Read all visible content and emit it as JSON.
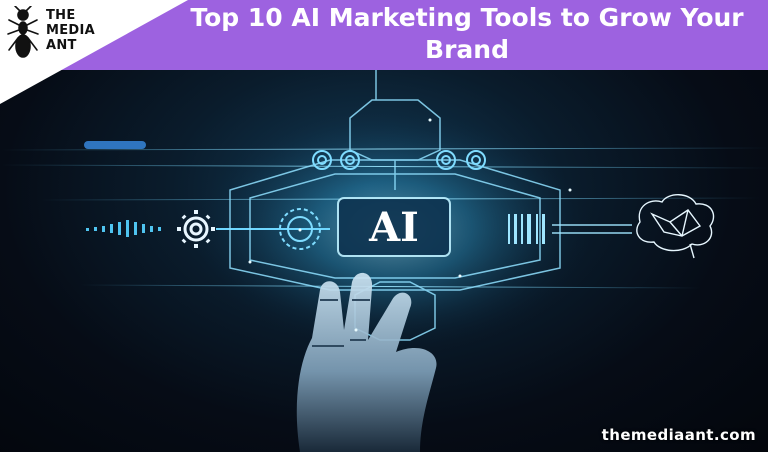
{
  "header": {
    "logo": {
      "line1": "THE",
      "line2": "MEDIA",
      "line3": "ANT"
    },
    "title": "Top 10 AI Marketing Tools to Grow Your Brand"
  },
  "hero": {
    "chip_label": "AI"
  },
  "footer": {
    "website": "themediaant.com"
  },
  "colors": {
    "header_bg": "#9d62e0",
    "glow": "#5fd0ff",
    "background": "#050a14"
  }
}
